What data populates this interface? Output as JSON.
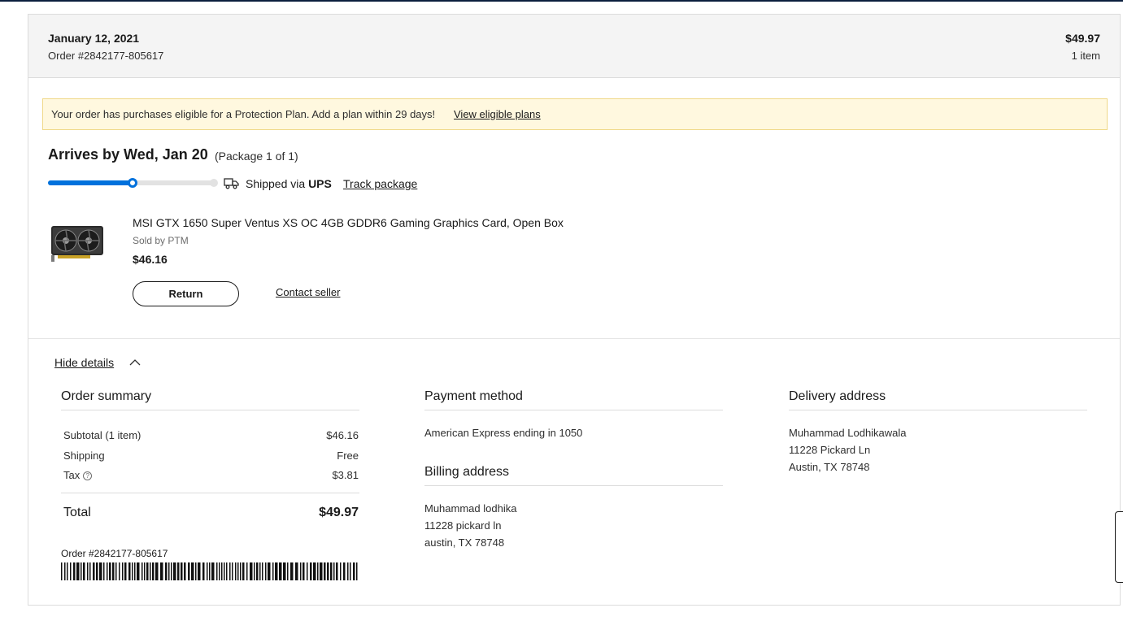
{
  "order": {
    "date": "January 12, 2021",
    "number": "Order #2842177-805617",
    "total": "$49.97",
    "item_count": "1 item"
  },
  "banner": {
    "text": "Your order has purchases eligible for a Protection Plan. Add a plan within 29 days!",
    "link": "View eligible plans"
  },
  "shipment": {
    "arrives": "Arrives by Wed, Jan 20",
    "package": "(Package 1 of 1)",
    "progress": 0.5,
    "shipped_prefix": "Shipped via",
    "carrier": "UPS",
    "track_link": "Track package",
    "truck_icon": "truck-icon"
  },
  "product": {
    "name": "MSI GTX 1650 Super Ventus XS OC 4GB GDDR6 Gaming Graphics Card, Open Box",
    "sold_by": "Sold by PTM",
    "price": "$46.16",
    "return_label": "Return",
    "contact_label": "Contact seller",
    "image_icon": "graphics-card-image"
  },
  "details": {
    "toggle_label": "Hide details",
    "summary": {
      "title": "Order summary",
      "subtotal_label": "Subtotal (1 item)",
      "subtotal_value": "$46.16",
      "shipping_label": "Shipping",
      "shipping_value": "Free",
      "tax_label": "Tax",
      "tax_value": "$3.81",
      "total_label": "Total",
      "total_value": "$49.97",
      "barcode_order": "Order #2842177-805617"
    },
    "payment": {
      "title": "Payment method",
      "card": "American Express ending in 1050"
    },
    "billing": {
      "title": "Billing address",
      "name": "Muhammad lodhika",
      "street": "11228 pickard ln",
      "city": "austin, TX 78748"
    },
    "delivery": {
      "title": "Delivery address",
      "name": "Muhammad Lodhikawala",
      "street": "11228 Pickard Ln",
      "city": "Austin, TX 78748"
    }
  },
  "colors": {
    "accent": "#0071dc",
    "banner_bg": "#fff8df",
    "header_bg": "#f4f4f4"
  }
}
